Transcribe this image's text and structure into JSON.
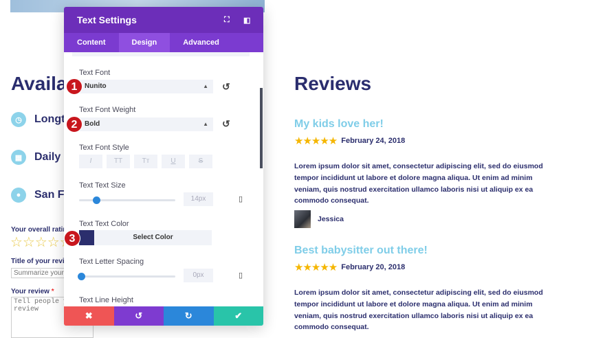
{
  "left": {
    "heading": "Availa",
    "features": [
      "Longte",
      "Daily C",
      "San Fr"
    ],
    "rating_label": "Your overall ratin",
    "title_label": "Title of your revi",
    "title_placeholder": "Summarize your r",
    "review_label": "Your review",
    "required_mark": "*",
    "review_placeholder": "Tell people yo review"
  },
  "reviews": {
    "heading": "Reviews",
    "items": [
      {
        "title": "My kids love her!",
        "stars": 5,
        "date": "February 24, 2018",
        "body": "Lorem ipsum dolor sit amet, consectetur adipiscing elit, sed do eiusmod tempor incididunt ut labore et dolore magna aliqua. Ut enim ad minim veniam, quis nostrud exercitation ullamco laboris nisi ut aliquip ex ea commodo consequat.",
        "author": "Jessica"
      },
      {
        "title": "Best babysitter out there!",
        "stars": 5,
        "date": "February 20, 2018",
        "body": "Lorem ipsum dolor sit amet, consectetur adipiscing elit, sed do eiusmod tempor incididunt ut labore et dolore magna aliqua. Ut enim ad minim veniam, quis nostrud exercitation ullamco laboris nisi ut aliquip ex ea commodo consequat."
      }
    ]
  },
  "modal": {
    "title": "Text Settings",
    "tabs": [
      "Content",
      "Design",
      "Advanced"
    ],
    "active_tab": "Design",
    "font_label": "Text Font",
    "font_value": "Nunito",
    "weight_label": "Text Font Weight",
    "weight_value": "Bold",
    "style_label": "Text Font Style",
    "style_buttons": [
      "I",
      "TT",
      "Tт",
      "U",
      "S"
    ],
    "size_label": "Text Text Size",
    "size_value": "14px",
    "size_fraction": 0.16,
    "color_label": "Text Text Color",
    "color_button": "Select Color",
    "color_value": "#2b2e6d",
    "spacing_label": "Text Letter Spacing",
    "spacing_value": "0px",
    "spacing_fraction": 0.0,
    "line_height_label": "Text Line Height"
  },
  "badges": [
    "1",
    "2",
    "3"
  ],
  "colors": {
    "purple": "#6c2eb9",
    "accent_blue": "#7fcde8",
    "navy": "#2b2e6d",
    "gold": "#f5b600"
  }
}
